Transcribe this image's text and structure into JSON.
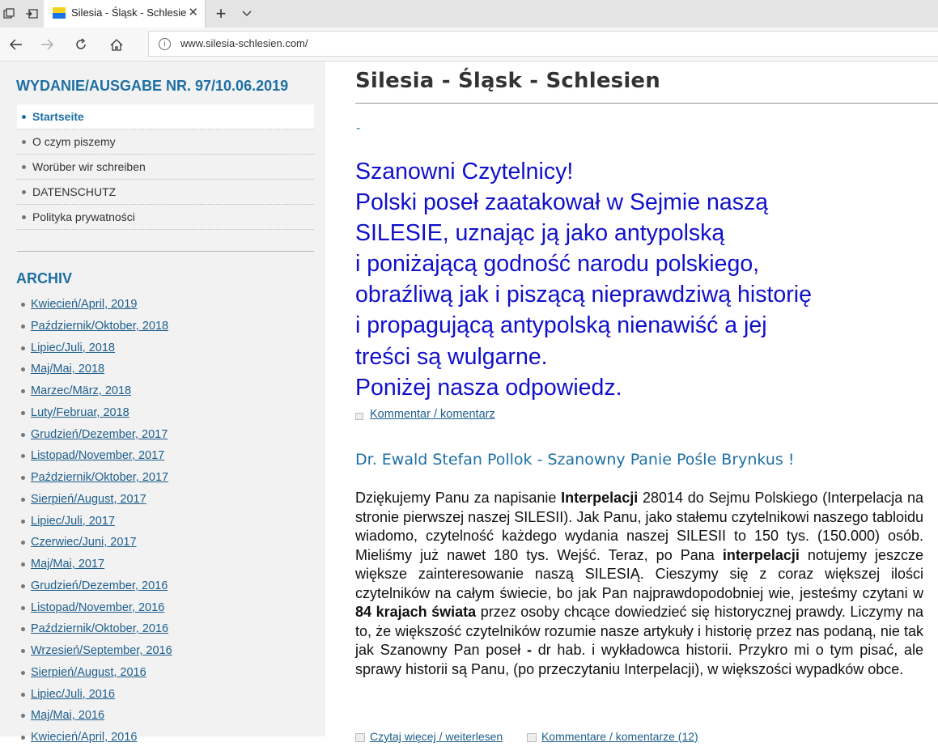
{
  "browser": {
    "tab_title": "Silesia - Śląsk - Schlesie",
    "tab_close": "✕",
    "new_tab": "+",
    "tab_menu": "⌵",
    "url": "www.silesia-schlesien.com/",
    "icons": [
      "tab-preview-icon",
      "set-aside-tabs-icon",
      "back-icon",
      "forward-icon",
      "refresh-icon",
      "home-icon",
      "site-info-icon"
    ]
  },
  "sidebar": {
    "edition_title": "WYDANIE/AUSGABE NR. 97/10.06.2019",
    "menu": [
      {
        "label": "Startseite",
        "active": true
      },
      {
        "label": "O czym piszemy"
      },
      {
        "label": "Worüber wir schreiben"
      },
      {
        "label": "DATENSCHUTZ"
      },
      {
        "label": "Polityka prywatności"
      }
    ],
    "archive_title": "ARCHIV",
    "archive": [
      "Kwiecień/April, 2019",
      "Październik/Oktober, 2018",
      "Lipiec/Juli, 2018",
      "Maj/Mai, 2018",
      "Marzec/März, 2018",
      "Luty/Februar, 2018",
      "Grudzień/Dezember, 2017",
      "Listopad/November, 2017",
      "Październik/Oktober, 2017",
      "Sierpień/August, 2017",
      "Lipiec/Juli, 2017",
      "Czerwiec/Juni, 2017",
      "Maj/Mai, 2017",
      "Grudzień/Dezember, 2016",
      "Listopad/November, 2016",
      "Październik/Oktober, 2016",
      "Wrzesień/September, 2016",
      "Sierpień/August, 2016",
      "Lipiec/Juli, 2016",
      "Maj/Mai, 2016",
      "Kwiecień/April, 2016"
    ]
  },
  "main": {
    "site_title": "Silesia - Śląsk - Schlesien",
    "dash": "-",
    "headline": [
      "Szanowni Czytelnicy!",
      "Polski poseł zaatakował w Sejmie naszą",
      "SILESIE, uznając ją jako antypolską",
      "i poniżającą godność narodu polskiego,",
      "obraźliwą jak i piszącą nieprawdziwą historię",
      "i propagującą antypolską nienawiść a jej",
      "treści są wulgarne.",
      "Poniżej nasza odpowiedz."
    ],
    "comment_link": "Kommentar / komentarz",
    "article_title": "Dr. Ewald Stefan Pollok - Szanowny Panie Pośle Brynkus !",
    "article": {
      "p1": "Dziękujemy Panu za napisanie ",
      "b1": "Interpelacji",
      "p2": " 28014 do Sejmu Polskiego (Interpelacja na stronie pierwszej naszej SILESII). Jak Panu, jako stałemu czytelnikowi naszego tabloidu wiadomo, czytelność każdego wydania naszej SILESII to 150 tys. (150.000) osób. Mieliśmy już nawet 180 tys. Wejść. Teraz, po Pana ",
      "b2": "interpelacji",
      "p3": " notujemy jeszcze większe zainteresowanie naszą SILESIĄ. Cieszymy się z coraz większej ilości czytelników na całym świecie, bo jak Pan najprawdopodobniej wie, jesteśmy czytani w ",
      "b3": "84 krajach świata",
      "p4": " przez osoby chcące dowiedzieć się historycznej prawdy. Liczymy na to, że większość czytelników rozumie nasze artykuły i historię przez nas podaną, nie tak jak Szanowny Pan poseł ",
      "b4": "-",
      "p5": " dr hab. i wykładowca historii. Przykro mi o tym pisać, ale sprawy historii są Panu, (po przeczytaniu Interpelacji), w większości wypadków obce."
    },
    "read_more": "Czytaj więcej / weiterlesen",
    "comments_count": "Kommentare / komentarze (12)"
  }
}
